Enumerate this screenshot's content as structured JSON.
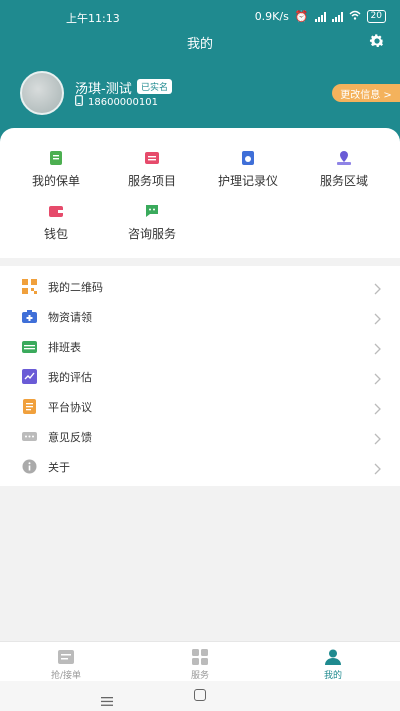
{
  "status": {
    "time": "上午11:13",
    "speed": "0.9K/s",
    "battery": "20"
  },
  "header": {
    "title": "我的"
  },
  "user": {
    "name": "汤琪-测试",
    "badge": "已实名",
    "phone": "18600000101",
    "edit_label": "更改信息 >"
  },
  "grid": [
    {
      "label": "我的保单",
      "icon": "policy-icon",
      "color": "#4caf50"
    },
    {
      "label": "服务项目",
      "icon": "service-items-icon",
      "color": "#e64b6b"
    },
    {
      "label": "护理记录仪",
      "icon": "recorder-icon",
      "color": "#3f6fd8"
    },
    {
      "label": "服务区域",
      "icon": "service-area-icon",
      "color": "#6a5bd6"
    },
    {
      "label": "钱包",
      "icon": "wallet-icon",
      "color": "#e64b6b"
    },
    {
      "label": "咨询服务",
      "icon": "consult-icon",
      "color": "#3aaa5c"
    }
  ],
  "list": [
    {
      "label": "我的二维码",
      "icon": "qrcode-icon",
      "color": "#f0a03c"
    },
    {
      "label": "物资请领",
      "icon": "supplies-icon",
      "color": "#3f6fd8"
    },
    {
      "label": "排班表",
      "icon": "schedule-icon",
      "color": "#3aaa5c"
    },
    {
      "label": "我的评估",
      "icon": "assessment-icon",
      "color": "#6a5bd6"
    },
    {
      "label": "平台协议",
      "icon": "agreement-icon",
      "color": "#f0a03c"
    },
    {
      "label": "意见反馈",
      "icon": "feedback-icon",
      "color": "#bbbbbb"
    },
    {
      "label": "关于",
      "icon": "about-icon",
      "color": "#aaaaaa"
    }
  ],
  "tabs": [
    {
      "label": "抢/接单",
      "icon": "order-icon"
    },
    {
      "label": "服务",
      "icon": "service-grid-icon"
    },
    {
      "label": "我的",
      "icon": "profile-icon"
    }
  ],
  "colors": {
    "primary": "#1f8a8f",
    "edit_button": "#f4b25c"
  }
}
